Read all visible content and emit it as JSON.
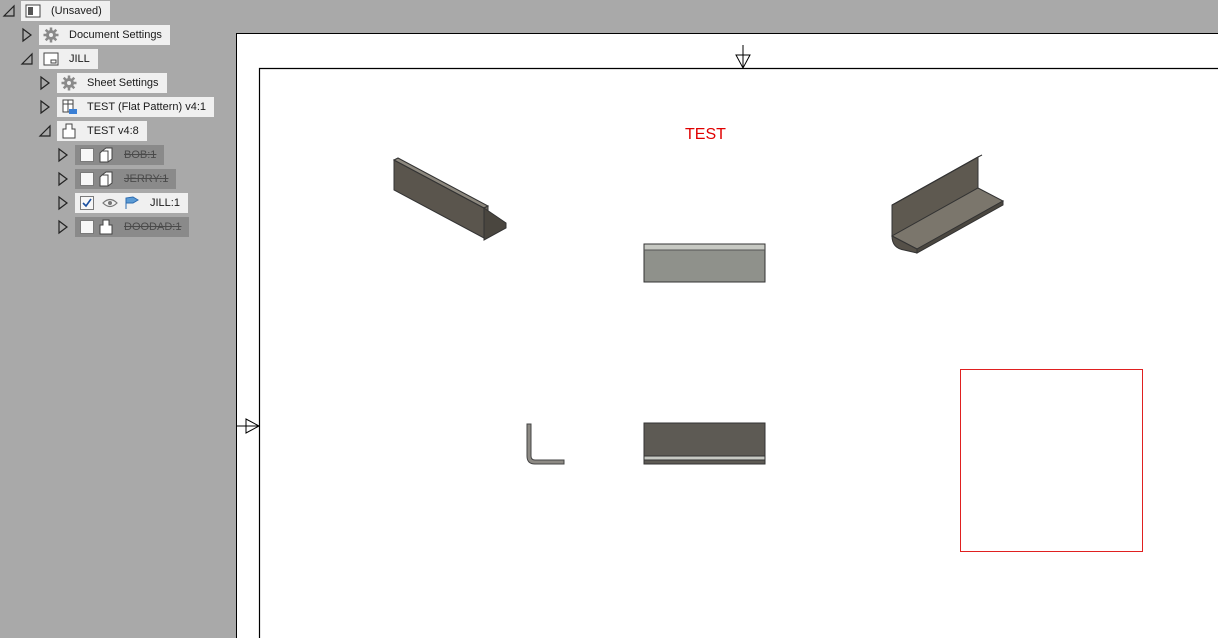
{
  "browser": {
    "root": {
      "label": "(Unsaved)"
    },
    "document_settings": {
      "label": "Document Settings"
    },
    "sheet": {
      "label": "JILL"
    },
    "sheet_settings": {
      "label": "Sheet Settings"
    },
    "flat_pattern": {
      "label": "TEST (Flat Pattern) v4:1"
    },
    "component": {
      "label": "TEST v4:8"
    },
    "bodies": [
      {
        "label": "BOB:1",
        "checked": false,
        "suppressed": true
      },
      {
        "label": "JERRY:1",
        "checked": false,
        "suppressed": true
      },
      {
        "label": "JILL:1",
        "checked": true,
        "suppressed": false
      },
      {
        "label": "DOODAD:1",
        "checked": false,
        "suppressed": true
      }
    ]
  },
  "canvas": {
    "sheet_text": "TEST",
    "text_color": "#e00000",
    "rectangle_color": "#e02020"
  }
}
